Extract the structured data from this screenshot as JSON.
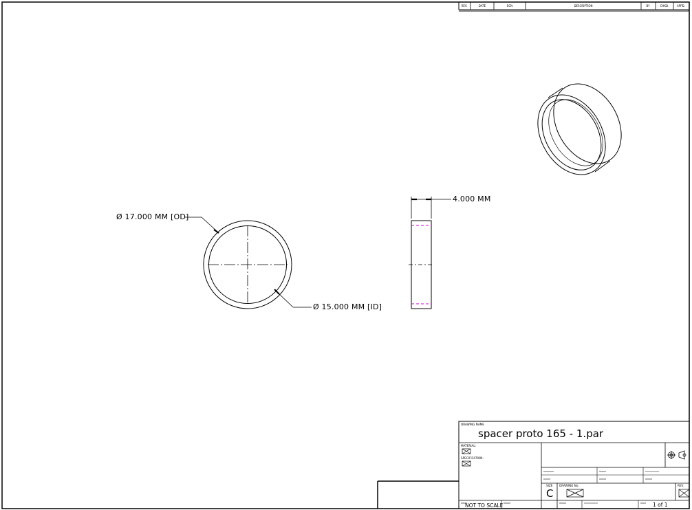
{
  "revision_block": {
    "headers": [
      "REV.",
      "DATE",
      "ECN",
      "DESCRIPTION",
      "BY",
      "CHKD.",
      "APPD."
    ]
  },
  "dimensions": {
    "outer_diameter": "Ø 17.000 MM [OD]",
    "inner_diameter": "Ø 15.000 MM [ID]",
    "thickness": "4.000 MM"
  },
  "title_block": {
    "drawing_name_label": "DRAWING NAME",
    "drawing_name": "spacer proto 165 - 1.par",
    "material_label": "MATERIAL:",
    "specification_label": "SPECIFICATION:",
    "size_label": "SIZE",
    "size": "C",
    "drawing_no_label": "DRAWING No.",
    "rev_label": "REV.",
    "scale_note": "NOT TO SCALE",
    "sheet": "1 of 1"
  },
  "colors": {
    "line": "#000000",
    "hidden_line": "#cc00cc",
    "background": "#ffffff"
  }
}
